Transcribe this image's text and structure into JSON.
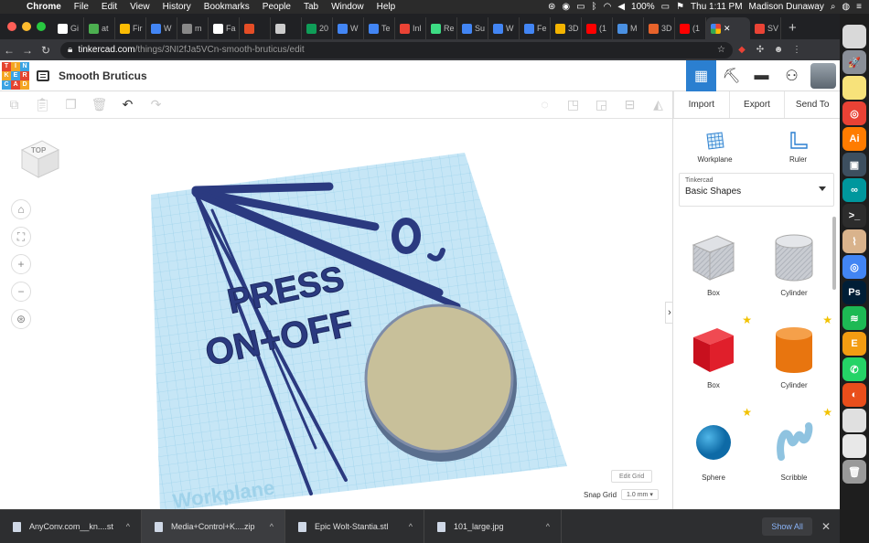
{
  "menubar": {
    "apple": "",
    "items": [
      "Chrome",
      "File",
      "Edit",
      "View",
      "History",
      "Bookmarks",
      "People",
      "Tab",
      "Window",
      "Help"
    ],
    "battery": "100%",
    "clock": "Thu 1:11 PM",
    "user": "Madison Dunaway"
  },
  "tabs": [
    {
      "label": "Gi",
      "color": "#ffffff"
    },
    {
      "label": "at",
      "color": "#4caf50"
    },
    {
      "label": "Fir",
      "color": "#fbbc04"
    },
    {
      "label": "W",
      "color": "#4285f4"
    },
    {
      "label": "m",
      "color": "#888888"
    },
    {
      "label": "Fa",
      "color": "#ffffff"
    },
    {
      "label": "",
      "color": "#e44d26"
    },
    {
      "label": "",
      "color": "#cccccc"
    },
    {
      "label": "20",
      "color": "#0f9d58"
    },
    {
      "label": "W",
      "color": "#4285f4"
    },
    {
      "label": "Te",
      "color": "#4285f4"
    },
    {
      "label": "Inl",
      "color": "#ea4335"
    },
    {
      "label": "Re",
      "color": "#3ddc84"
    },
    {
      "label": "Su",
      "color": "#4285f4"
    },
    {
      "label": "W",
      "color": "#4285f4"
    },
    {
      "label": "Fe",
      "color": "#4285f4"
    },
    {
      "label": "3D",
      "color": "#f4b400"
    },
    {
      "label": "(1",
      "color": "#ff0000"
    },
    {
      "label": "M",
      "color": "#4a90e2"
    },
    {
      "label": "3D",
      "color": "#e8632b"
    },
    {
      "label": "(1",
      "color": "#ff0000"
    }
  ],
  "active_tab": {
    "label": "",
    "close": "✕"
  },
  "last_tab": {
    "label": "SV",
    "color": "#ea4335"
  },
  "address": {
    "host": "tinkercad.com",
    "path": "/things/3NI2fJa5VCn-smooth-bruticus/edit"
  },
  "design": {
    "name": "Smooth Bruticus"
  },
  "logo": [
    "TIN",
    "KER",
    "CAD"
  ],
  "panel": {
    "import": "Import",
    "export": "Export",
    "send_to": "Send To",
    "workplane": "Workplane",
    "ruler": "Ruler",
    "library_label": "Tinkercad",
    "library_value": "Basic Shapes",
    "shapes": [
      {
        "name": "Box",
        "kind": "box-hole",
        "star": false
      },
      {
        "name": "Cylinder",
        "kind": "cyl-hole",
        "star": false
      },
      {
        "name": "Box",
        "kind": "box",
        "star": true
      },
      {
        "name": "Cylinder",
        "kind": "cyl",
        "star": true
      },
      {
        "name": "Sphere",
        "kind": "sphere",
        "star": true
      },
      {
        "name": "Scribble",
        "kind": "scribble",
        "star": true
      }
    ]
  },
  "workspace": {
    "viewcube": "TOP",
    "edit_grid": "Edit Grid",
    "snap_label": "Snap Grid",
    "snap_value": "1.0 mm ▾",
    "workplane_text": "Workplane",
    "model_text_1": "PRESS",
    "model_text_2": "ON+OFF"
  },
  "downloads": [
    {
      "name": "AnyConv.com__kn....st",
      "highlight": false
    },
    {
      "name": "Media+Control+K....zip",
      "highlight": true
    },
    {
      "name": "Epic Wolt-Stantia.stl",
      "highlight": false
    },
    {
      "name": "101_large.jpg",
      "highlight": false
    }
  ],
  "show_all": "Show All",
  "dock": [
    {
      "label": "",
      "color": "#d9d9d9"
    },
    {
      "label": "🚀",
      "color": "#8a8f98"
    },
    {
      "label": "",
      "color": "#f7e27a"
    },
    {
      "label": "◎",
      "color": "#e94235"
    },
    {
      "label": "Ai",
      "color": "#ff7c00"
    },
    {
      "label": "▣",
      "color": "#3d4f5f"
    },
    {
      "label": "∞",
      "color": "#00979d"
    },
    {
      "label": ">_",
      "color": "#2c2c2c"
    },
    {
      "label": "⌇",
      "color": "#d9b38c"
    },
    {
      "label": "◎",
      "color": "#4285f4"
    },
    {
      "label": "Ps",
      "color": "#001e36"
    },
    {
      "label": "≋",
      "color": "#1db954"
    },
    {
      "label": "E",
      "color": "#f39c12"
    },
    {
      "label": "✆",
      "color": "#25d366"
    },
    {
      "label": "◐",
      "color": "#e94e1b"
    },
    {
      "label": "",
      "color": "#e0e0e0"
    },
    {
      "label": "",
      "color": "#e8e8e8"
    },
    {
      "label": "🗑",
      "color": "#9a9a9a"
    }
  ]
}
